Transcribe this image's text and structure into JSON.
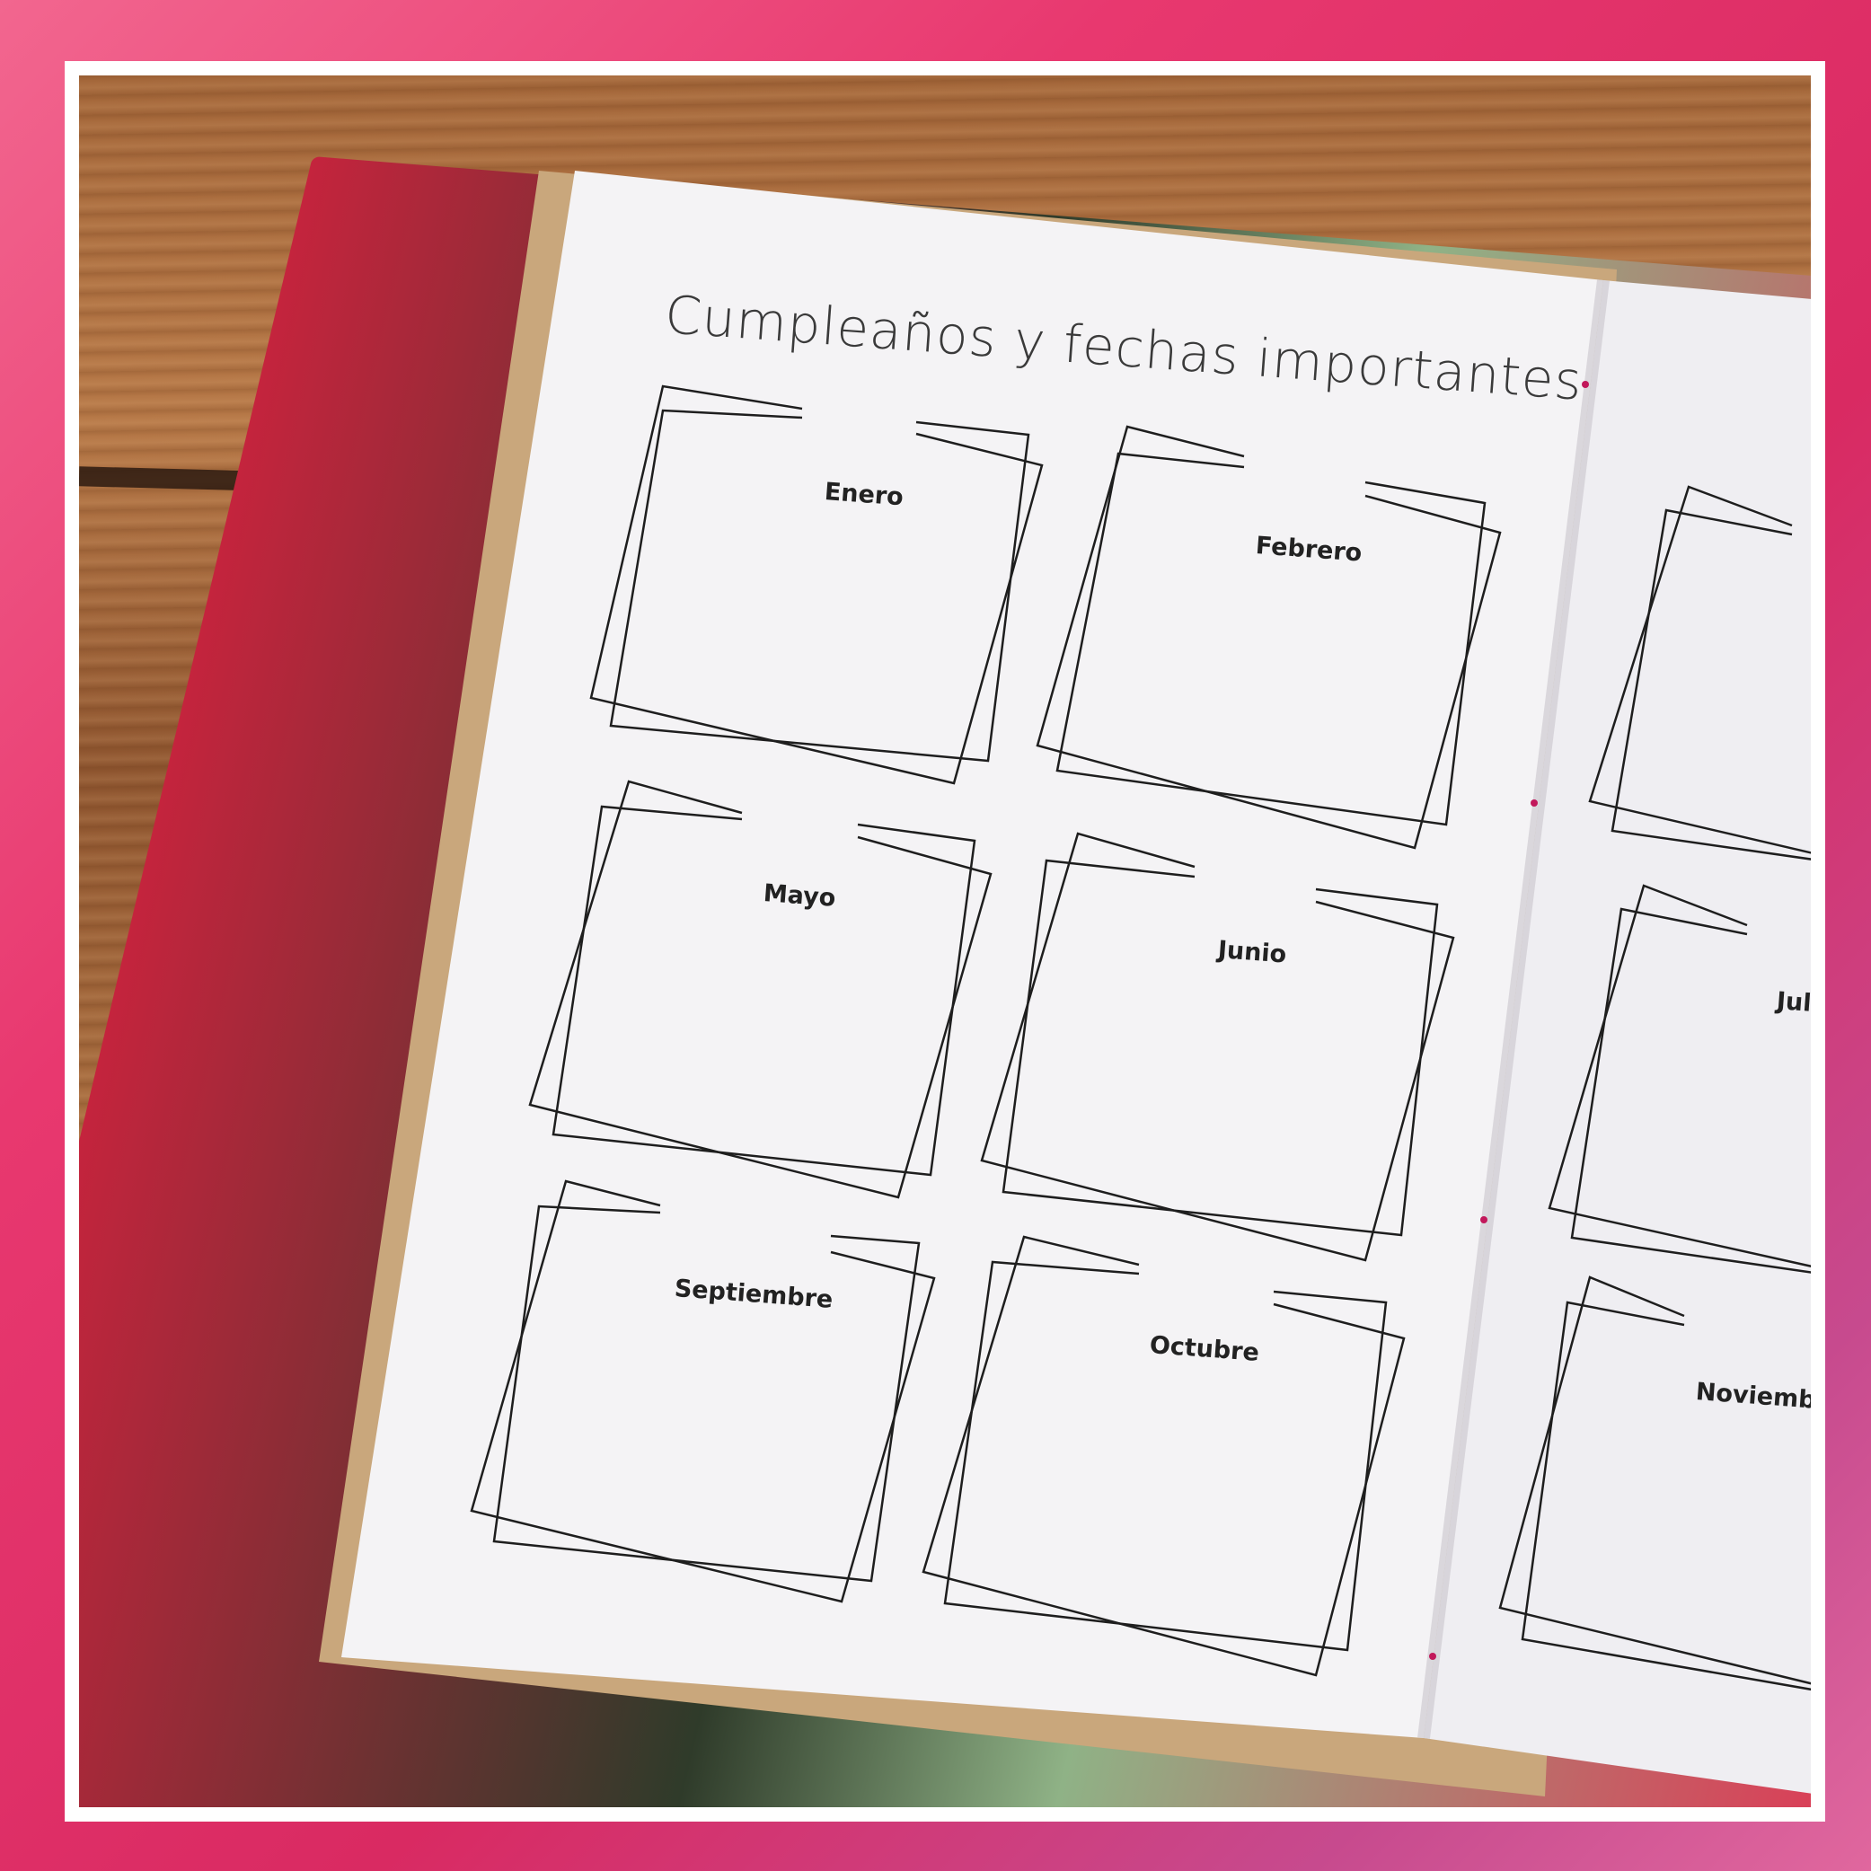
{
  "page": {
    "title": "Cumpleaños y fechas importantes",
    "months": [
      {
        "key": "enero",
        "label": "Enero"
      },
      {
        "key": "febrero",
        "label": "Febrero"
      },
      {
        "key": "mayo",
        "label": "Mayo"
      },
      {
        "key": "junio",
        "label": "Junio"
      },
      {
        "key": "septiembre",
        "label": "Septiembre"
      },
      {
        "key": "octubre",
        "label": "Octubre"
      },
      {
        "key": "julio",
        "label": "Juli"
      },
      {
        "key": "noviembre",
        "label": "Noviembr"
      }
    ]
  },
  "colors": {
    "frame_pink": "#e8386f",
    "paper": "#f4f3f5",
    "ink": "#222222",
    "wood": "#a4673a"
  }
}
